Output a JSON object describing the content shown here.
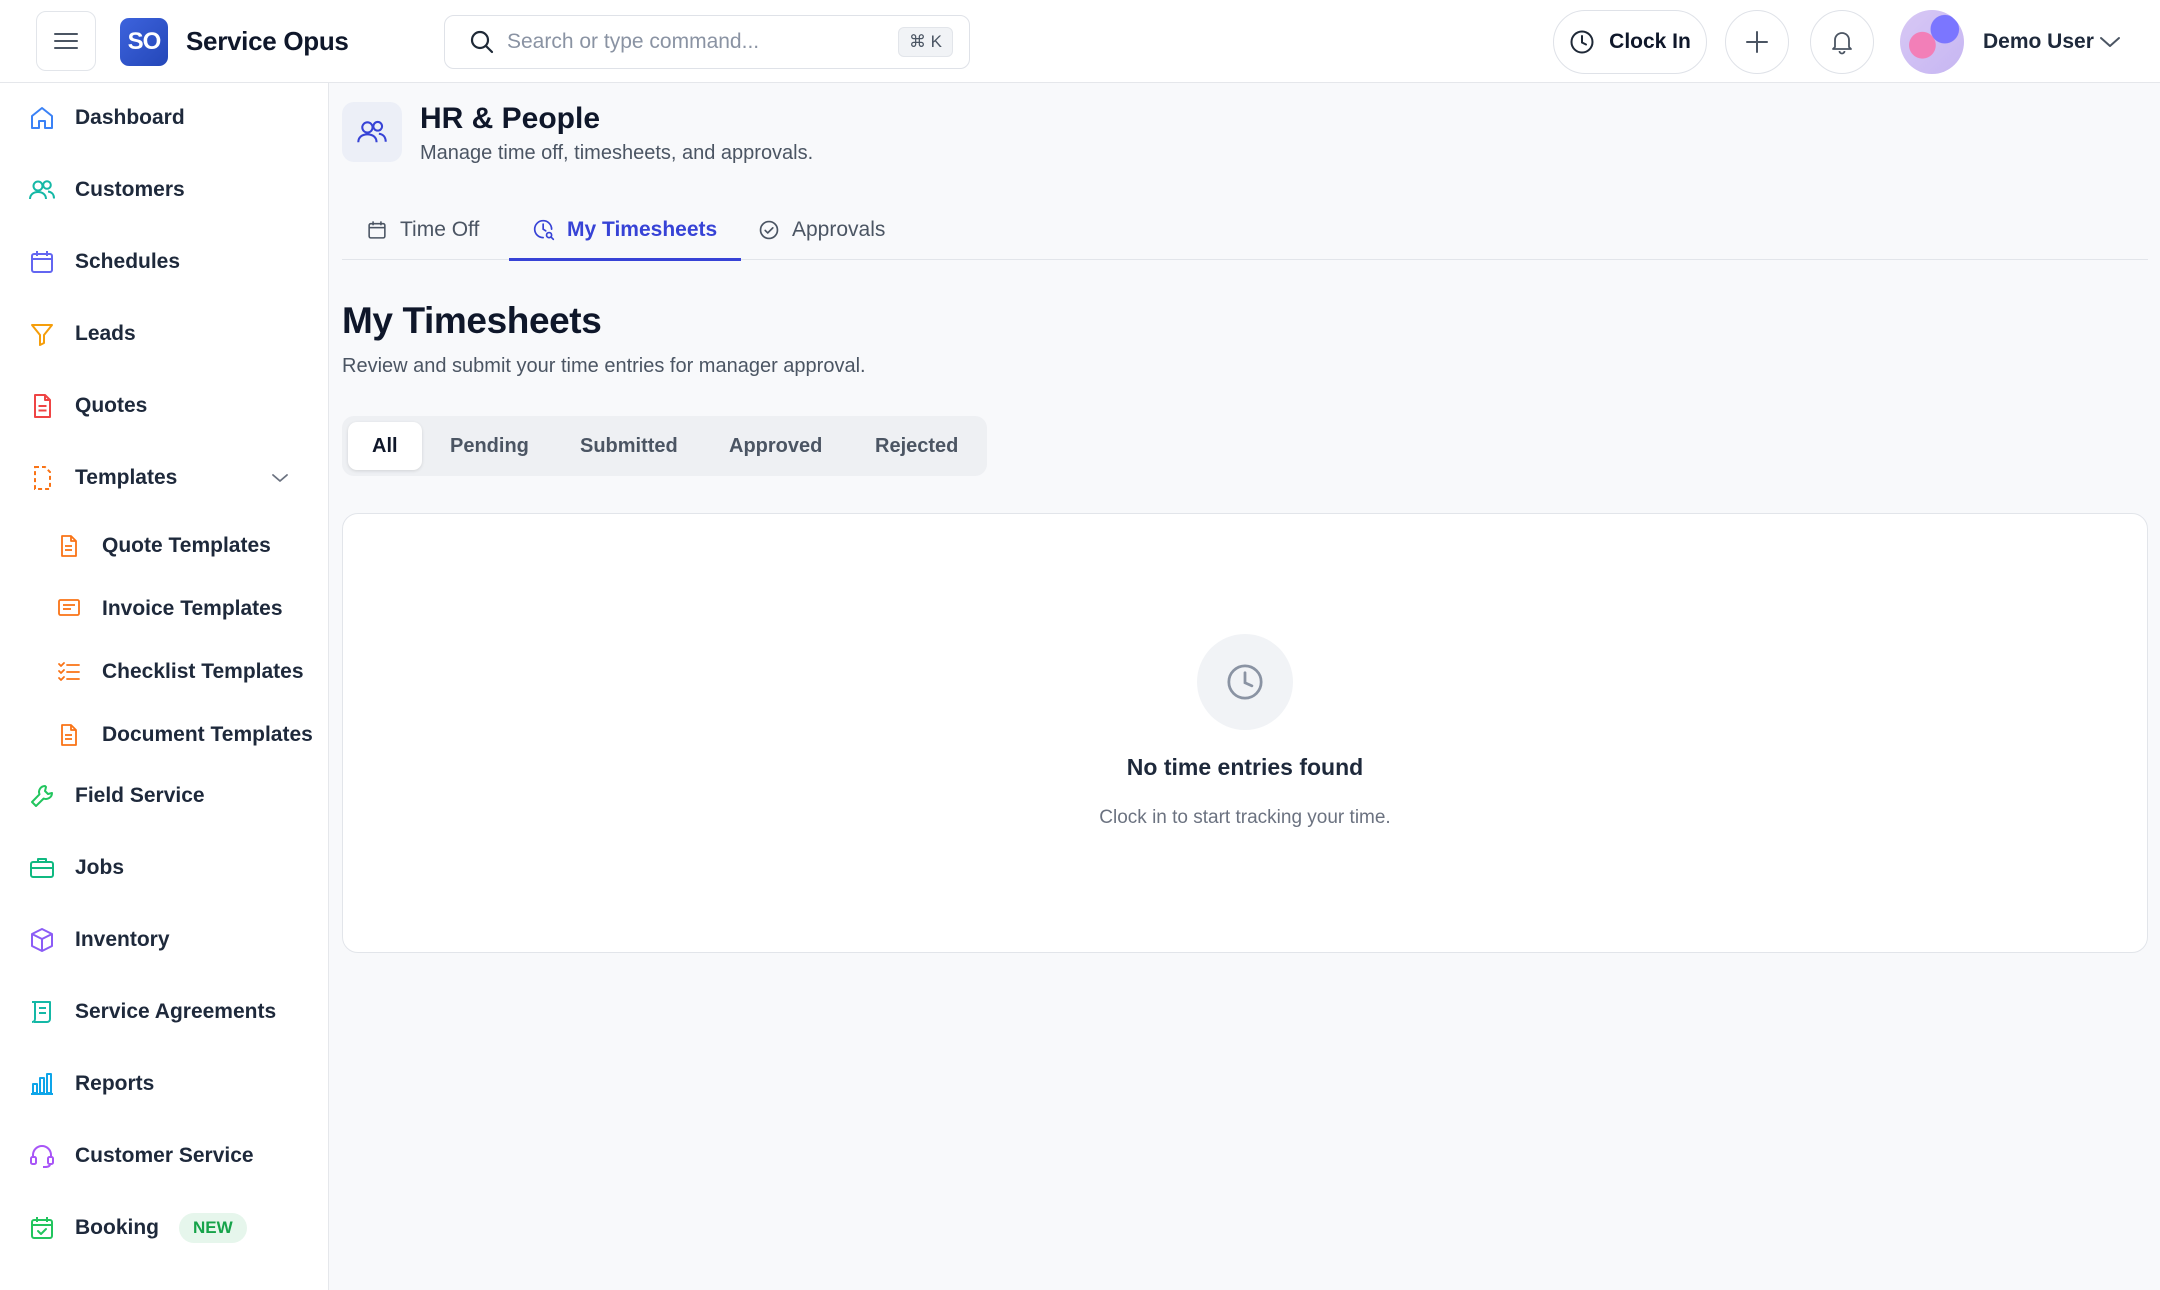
{
  "brand": {
    "logo_text": "SO",
    "name": "Service Opus"
  },
  "search": {
    "placeholder": "Search or type command...",
    "shortcut": "⌘ K"
  },
  "header_actions": {
    "clock_in_label": "Clock In",
    "user_name": "Demo User"
  },
  "sidebar": {
    "items": [
      {
        "label": "Dashboard",
        "icon": "home-icon",
        "color": "#3b82f6"
      },
      {
        "label": "Customers",
        "icon": "users-icon",
        "color": "#14b8a6"
      },
      {
        "label": "Schedules",
        "icon": "calendar-icon",
        "color": "#6366f1"
      },
      {
        "label": "Leads",
        "icon": "funnel-icon",
        "color": "#f59e0b"
      },
      {
        "label": "Quotes",
        "icon": "document-icon",
        "color": "#ef4444"
      },
      {
        "label": "Templates",
        "icon": "template-icon",
        "color": "#f97316"
      },
      {
        "label": "Field Service",
        "icon": "wrench-icon",
        "color": "#22c55e"
      },
      {
        "label": "Jobs",
        "icon": "briefcase-icon",
        "color": "#10b981"
      },
      {
        "label": "Inventory",
        "icon": "box-icon",
        "color": "#8b5cf6"
      },
      {
        "label": "Service Agreements",
        "icon": "scroll-icon",
        "color": "#14b8a6"
      },
      {
        "label": "Reports",
        "icon": "bar-chart-icon",
        "color": "#0ea5e9"
      },
      {
        "label": "Customer Service",
        "icon": "headset-icon",
        "color": "#a855f7"
      },
      {
        "label": "Booking",
        "icon": "calendar-check-icon",
        "color": "#22c55e",
        "badge": "NEW"
      }
    ],
    "template_subitems": [
      {
        "label": "Quote Templates",
        "icon": "file-icon"
      },
      {
        "label": "Invoice Templates",
        "icon": "receipt-icon"
      },
      {
        "label": "Checklist Templates",
        "icon": "checklist-icon"
      },
      {
        "label": "Document Templates",
        "icon": "file-text-icon"
      }
    ],
    "sub_icon_color": "#f97316"
  },
  "page_header": {
    "title": "HR & People",
    "subtitle": "Manage time off, timesheets, and approvals."
  },
  "tabs": [
    {
      "label": "Time Off",
      "active": false
    },
    {
      "label": "My Timesheets",
      "active": true
    },
    {
      "label": "Approvals",
      "active": false
    }
  ],
  "content": {
    "title": "My Timesheets",
    "subtitle": "Review and submit your time entries for manager approval.",
    "filters": [
      {
        "label": "All",
        "active": true
      },
      {
        "label": "Pending",
        "active": false
      },
      {
        "label": "Submitted",
        "active": false
      },
      {
        "label": "Approved",
        "active": false
      },
      {
        "label": "Rejected",
        "active": false
      }
    ],
    "empty_state": {
      "title": "No time entries found",
      "subtitle": "Clock in to start tracking your time."
    }
  },
  "colors": {
    "accent": "#3743d6",
    "brand": "#2d52c9",
    "new_badge": "#16a34a"
  }
}
